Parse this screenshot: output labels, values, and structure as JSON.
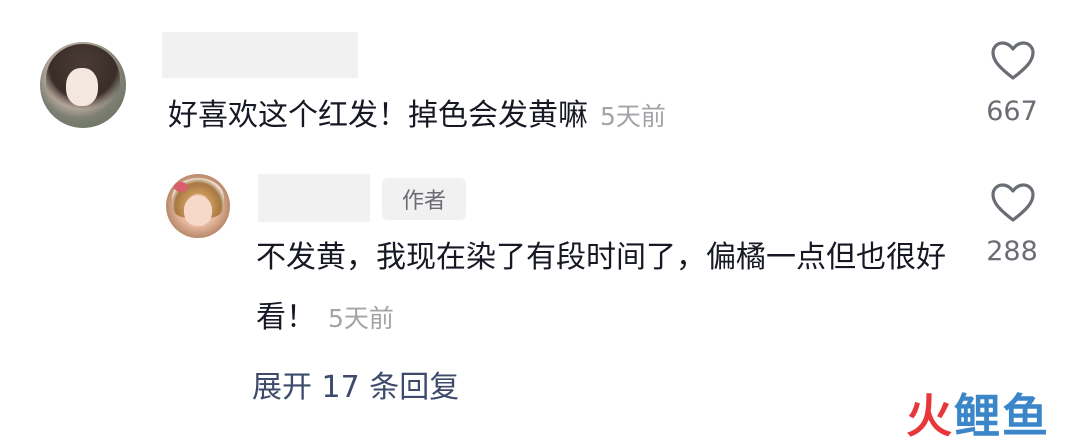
{
  "comment": {
    "text": "好喜欢这个红发！掉色会发黄嘛",
    "time": "5天前",
    "likes": "667"
  },
  "reply": {
    "badge": "作者",
    "text": "不发黄，我现在染了有段时间了，偏橘一点但也很好看！",
    "time": "5天前",
    "likes": "288"
  },
  "expand_label": "展开 17 条回复",
  "watermark": {
    "part1": "火",
    "part2": "鲤鱼"
  },
  "colors": {
    "text": "#161823",
    "secondary": "#a3a4a8",
    "link": "#3d4a6b",
    "watermark_red": "#e8373b",
    "watermark_blue": "#3a86c8"
  }
}
